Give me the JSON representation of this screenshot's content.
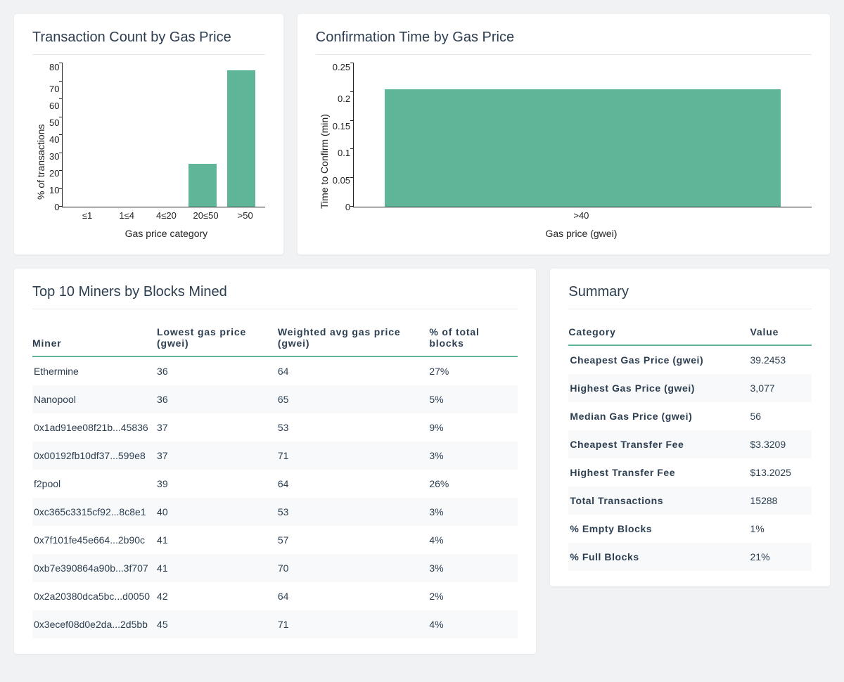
{
  "chart_data": [
    {
      "type": "bar",
      "id": "tx-count-by-gas",
      "title": "Transaction Count by Gas Price",
      "xlabel": "Gas price category",
      "ylabel": "% of transactions",
      "categories": [
        "≤1",
        "1≤4",
        "4≤20",
        "20≤50",
        ">50"
      ],
      "values": [
        0,
        0,
        0,
        24,
        76
      ],
      "ylim": [
        0,
        80
      ],
      "yticks": [
        0,
        10,
        20,
        30,
        40,
        50,
        60,
        70,
        80
      ]
    },
    {
      "type": "bar",
      "id": "confirm-time-by-gas",
      "title": "Confirmation Time by Gas Price",
      "xlabel": "Gas price (gwei)",
      "ylabel": "Time to Confirm (min)",
      "categories": [
        ">40"
      ],
      "values": [
        0.205
      ],
      "ylim": [
        0,
        0.25
      ],
      "yticks": [
        0,
        0.05,
        0.1,
        0.15,
        0.2,
        0.25
      ]
    }
  ],
  "miners": {
    "title": "Top 10 Miners by Blocks Mined",
    "columns": [
      "Miner",
      "Lowest gas price (gwei)",
      "Weighted avg gas price (gwei)",
      "% of total blocks"
    ],
    "rows": [
      {
        "miner": "Ethermine",
        "lowest": "36",
        "weighted": "64",
        "pct": "27%"
      },
      {
        "miner": "Nanopool",
        "lowest": "36",
        "weighted": "65",
        "pct": "5%"
      },
      {
        "miner": "0x1ad91ee08f21b...45836",
        "lowest": "37",
        "weighted": "53",
        "pct": "9%"
      },
      {
        "miner": "0x00192fb10df37...599e8",
        "lowest": "37",
        "weighted": "71",
        "pct": "3%"
      },
      {
        "miner": "f2pool",
        "lowest": "39",
        "weighted": "64",
        "pct": "26%"
      },
      {
        "miner": "0xc365c3315cf92...8c8e1",
        "lowest": "40",
        "weighted": "53",
        "pct": "3%"
      },
      {
        "miner": "0x7f101fe45e664...2b90c",
        "lowest": "41",
        "weighted": "57",
        "pct": "4%"
      },
      {
        "miner": "0xb7e390864a90b...3f707",
        "lowest": "41",
        "weighted": "70",
        "pct": "3%"
      },
      {
        "miner": "0x2a20380dca5bc...d0050",
        "lowest": "42",
        "weighted": "64",
        "pct": "2%"
      },
      {
        "miner": "0x3ecef08d0e2da...2d5bb",
        "lowest": "45",
        "weighted": "71",
        "pct": "4%"
      }
    ]
  },
  "summary": {
    "title": "Summary",
    "columns": [
      "Category",
      "Value"
    ],
    "rows": [
      {
        "cat": "Cheapest Gas Price (gwei)",
        "val": "39.2453"
      },
      {
        "cat": "Highest Gas Price (gwei)",
        "val": "3,077"
      },
      {
        "cat": "Median Gas Price (gwei)",
        "val": "56"
      },
      {
        "cat": "Cheapest Transfer Fee",
        "val": "$3.3209"
      },
      {
        "cat": "Highest Transfer Fee",
        "val": "$13.2025"
      },
      {
        "cat": "Total Transactions",
        "val": "15288"
      },
      {
        "cat": "% Empty Blocks",
        "val": "1%"
      },
      {
        "cat": "% Full Blocks",
        "val": "21%"
      }
    ]
  }
}
